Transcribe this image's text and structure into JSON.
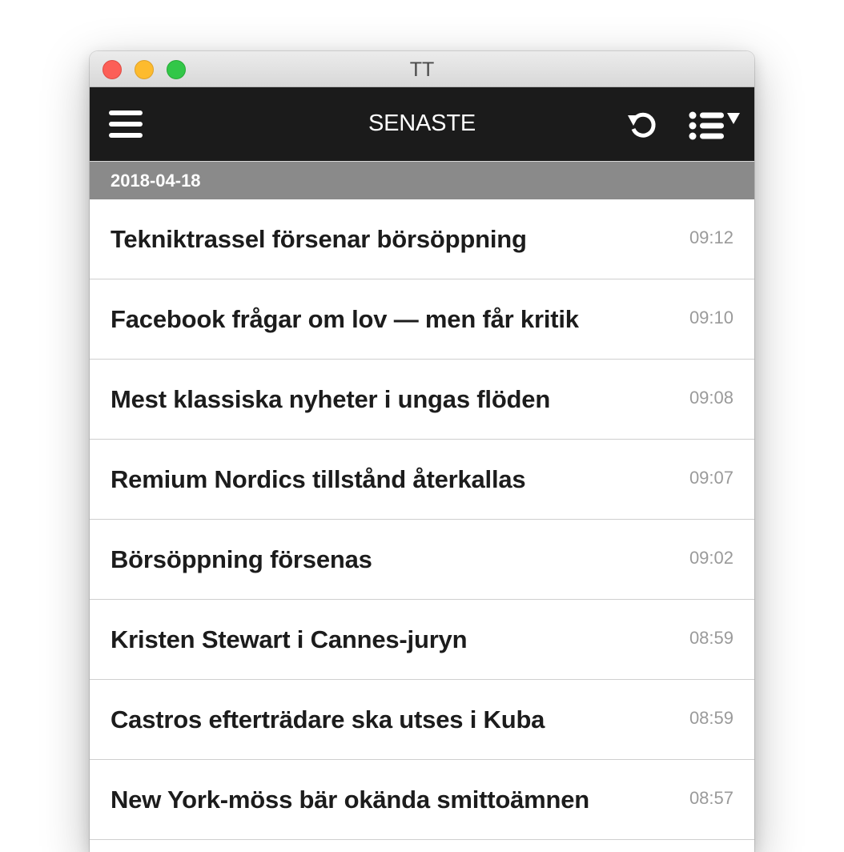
{
  "window": {
    "title": "TT"
  },
  "appbar": {
    "title": "SENASTE",
    "menu_icon": "hamburger-menu-icon",
    "refresh_icon": "refresh-icon",
    "list_icon": "list-dropdown-icon"
  },
  "colors": {
    "appbar_bg": "#1b1b1b",
    "date_header_bg": "#8a8a8a",
    "headline": "#1c1c1c",
    "time": "#9a9a9a",
    "close": "#fc5f57",
    "minimize": "#fdbb2e",
    "maximize": "#32c748"
  },
  "date_header": "2018-04-18",
  "items": [
    {
      "headline": "Tekniktrassel försenar börsöppning",
      "time": "09:12"
    },
    {
      "headline": "Facebook frågar om lov — men får kritik",
      "time": "09:10"
    },
    {
      "headline": "Mest klassiska nyheter i ungas flöden",
      "time": "09:08"
    },
    {
      "headline": "Remium Nordics tillstånd återkallas",
      "time": "09:07"
    },
    {
      "headline": "Börsöppning försenas",
      "time": "09:02"
    },
    {
      "headline": "Kristen Stewart i Cannes-juryn",
      "time": "08:59"
    },
    {
      "headline": "Castros efterträdare ska utses i Kuba",
      "time": "08:59"
    },
    {
      "headline": "New York-möss bär okända smittoämnen",
      "time": "08:57"
    }
  ]
}
